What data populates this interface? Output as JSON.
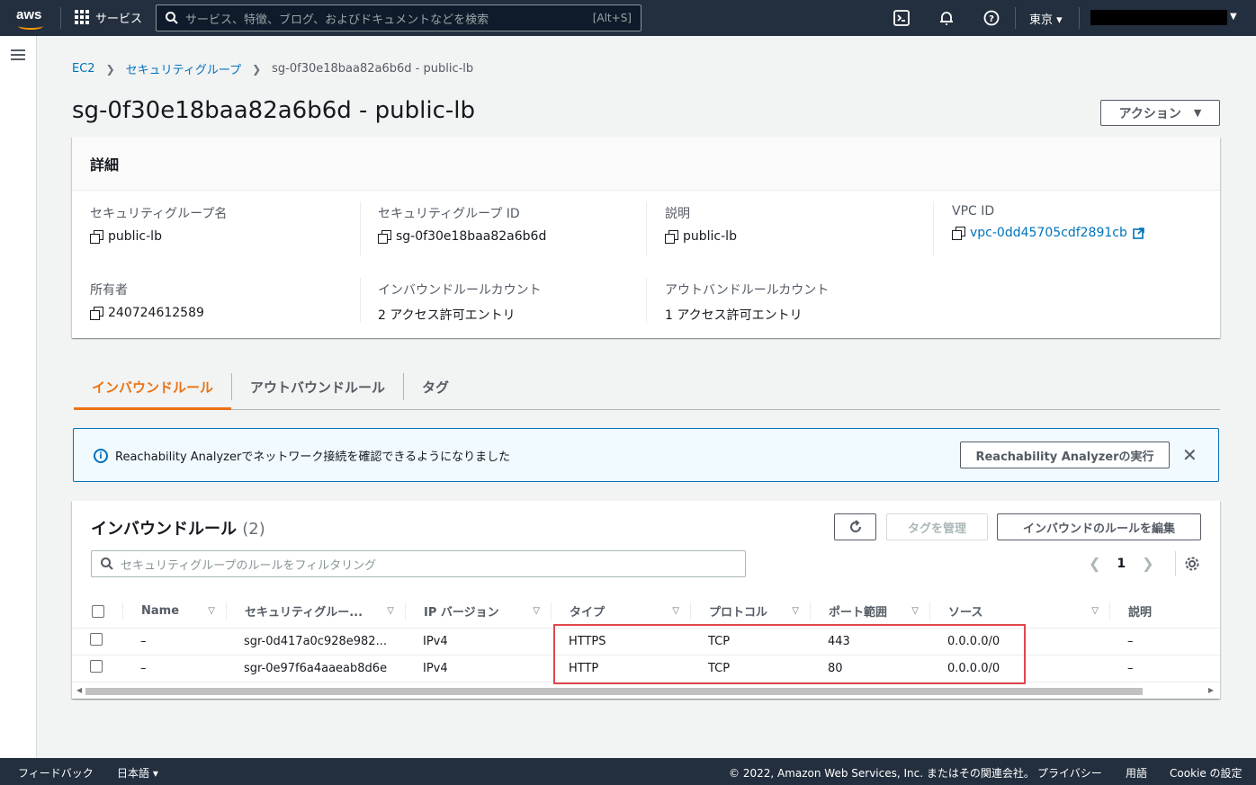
{
  "topnav": {
    "logo_text": "aws",
    "services_label": "サービス",
    "search_placeholder": "サービス、特徴、ブログ、およびドキュメントなどを検索",
    "search_shortcut": "[Alt+S]",
    "region": "東京 ▾"
  },
  "breadcrumb": {
    "items": [
      "EC2",
      "セキュリティグループ"
    ],
    "current": "sg-0f30e18baa82a6b6d - public-lb"
  },
  "page_title": "sg-0f30e18baa82a6b6d - public-lb",
  "actions_label": "アクション",
  "details": {
    "heading": "詳細",
    "fields": [
      {
        "key": "セキュリティグループ名",
        "value": "public-lb"
      },
      {
        "key": "セキュリティグループ ID",
        "value": "sg-0f30e18baa82a6b6d"
      },
      {
        "key": "説明",
        "value": "public-lb"
      },
      {
        "key": "VPC ID",
        "value": "vpc-0dd45705cdf2891cb"
      },
      {
        "key": "所有者",
        "value": "240724612589"
      },
      {
        "key": "インバウンドルールカウント",
        "value": "2 アクセス許可エントリ"
      },
      {
        "key": "アウトバンドルールカウント",
        "value": "1 アクセス許可エントリ"
      }
    ]
  },
  "tabs": [
    "インバウンドルール",
    "アウトバウンドルール",
    "タグ"
  ],
  "flash": {
    "message": "Reachability Analyzerでネットワーク接続を確認できるようになりました",
    "button": "Reachability Analyzerの実行",
    "close": "✕"
  },
  "rules_table": {
    "title": "インバウンドルール",
    "count": "(2)",
    "manage_tags": "タグを管理",
    "edit_rules": "インバウンドのルールを編集",
    "filter_placeholder": "セキュリティグループのルールをフィルタリング",
    "page": "1",
    "columns": [
      "Name",
      "セキュリティグルー...",
      "IP バージョン",
      "タイプ",
      "プロトコル",
      "ポート範囲",
      "ソース",
      "説明"
    ],
    "rows": [
      {
        "name": "–",
        "id": "sgr-0d417a0c928e982...",
        "ip": "IPv4",
        "type": "HTTPS",
        "protocol": "TCP",
        "port": "443",
        "source": "0.0.0.0/0",
        "desc": "–"
      },
      {
        "name": "–",
        "id": "sgr-0e97f6a4aaeab8d6e",
        "ip": "IPv4",
        "type": "HTTP",
        "protocol": "TCP",
        "port": "80",
        "source": "0.0.0.0/0",
        "desc": "–"
      }
    ]
  },
  "footer": {
    "feedback": "フィードバック",
    "language": "日本語 ▾",
    "copyright": "© 2022, Amazon Web Services, Inc. またはその関連会社。",
    "privacy": "プライバシー",
    "terms": "用語",
    "cookie": "Cookie の設定"
  }
}
